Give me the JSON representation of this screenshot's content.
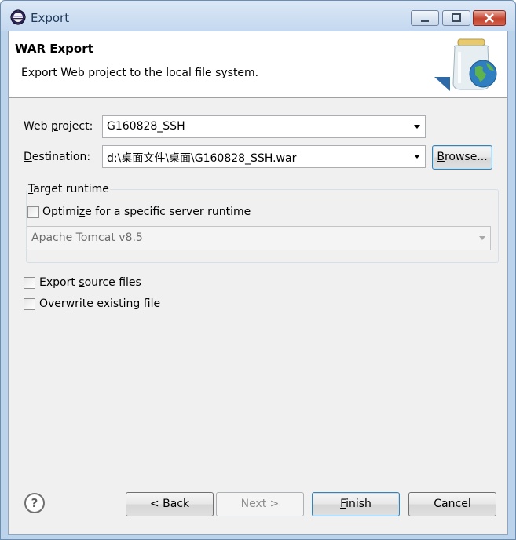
{
  "window": {
    "title": "Export"
  },
  "banner": {
    "title": "WAR Export",
    "description": "Export Web project to the local file system."
  },
  "form": {
    "web_project_label_pre": "Web ",
    "web_project_label_u": "p",
    "web_project_label_post": "roject:",
    "web_project_value": "G160828_SSH",
    "destination_label_u": "D",
    "destination_label_post": "estination:",
    "destination_value": "d:\\桌面文件\\桌面\\G160828_SSH.war",
    "browse_u": "B",
    "browse_post": "rowse..."
  },
  "target_runtime": {
    "legend_u": "T",
    "legend_post": "arget runtime",
    "optimize_pre": "Optimi",
    "optimize_u": "z",
    "optimize_post": "e for a specific server runtime",
    "optimize_checked": false,
    "runtime_value": "Apache Tomcat v8.5"
  },
  "options": {
    "export_source_pre": "Export ",
    "export_source_u": "s",
    "export_source_post": "ource files",
    "export_source_checked": false,
    "overwrite_pre": "Over",
    "overwrite_u": "w",
    "overwrite_post": "rite existing file",
    "overwrite_checked": false
  },
  "footer": {
    "help_glyph": "?",
    "back_label": "< Back",
    "next_label": "Next >",
    "finish_u": "F",
    "finish_post": "inish",
    "cancel_label": "Cancel"
  }
}
